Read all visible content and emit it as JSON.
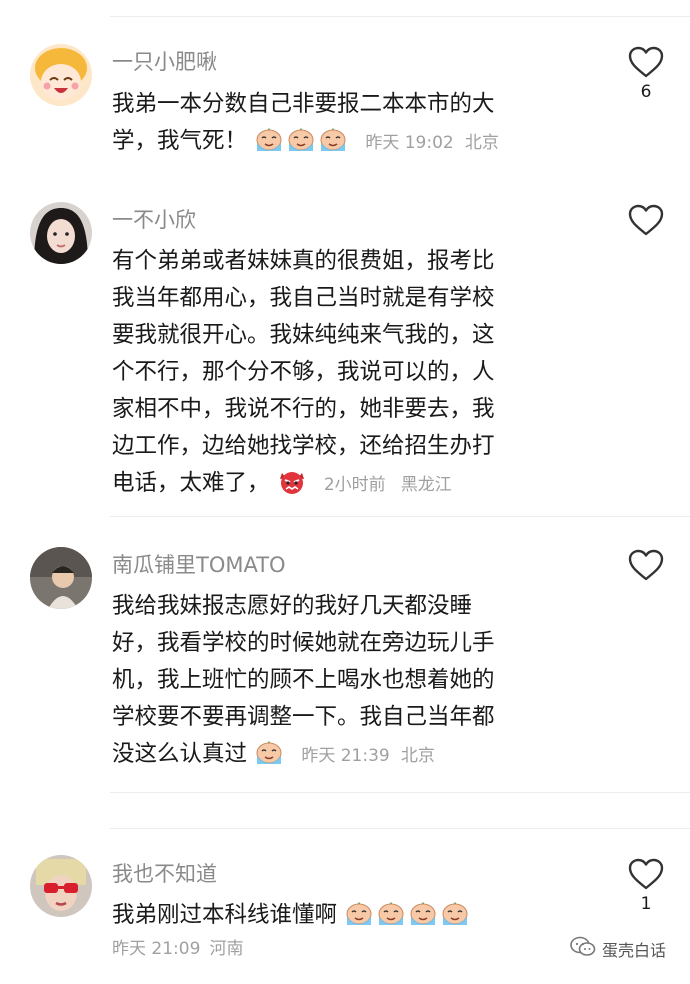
{
  "comments": [
    {
      "username": "一只小肥啾",
      "lines": [
        "我弟一本分数自己非要报二本本市的大",
        "学，我气死！"
      ],
      "time": "昨天 19:02",
      "location": "北京",
      "likes": "6",
      "emoji_count": 3,
      "emoji": "crying-face-emoji"
    },
    {
      "username": "一不小欣",
      "lines": [
        "有个弟弟或者妹妹真的很费姐，报考比",
        "我当年都用心，我自己当时就是有学校",
        "要我就很开心。我妹纯纯来气我的，这",
        "个不行，那个分不够，我说可以的，人",
        "家相不中，我说不行的，她非要去，我",
        "边工作，边给她找学校，还给招生办打",
        "电话，太难了，"
      ],
      "time": "2小时前",
      "location": "黑龙江",
      "likes": "",
      "emoji_count": 1,
      "emoji": "angry-devil-emoji"
    },
    {
      "username": "南瓜铺里TOMATO",
      "lines": [
        "我给我妹报志愿好的我好几天都没睡",
        "好，我看学校的时候她就在旁边玩儿手",
        "机，我上班忙的顾不上喝水也想着她的",
        "学校要不要再调整一下。我自己当年都",
        "没这么认真过"
      ],
      "time": "昨天 21:39",
      "location": "北京",
      "likes": "",
      "emoji_count": 1,
      "emoji": "crying-face-emoji"
    },
    {
      "username": "我也不知道",
      "lines": [
        "我弟刚过本科线谁懂啊"
      ],
      "time": "昨天 21:09",
      "location": "河南",
      "likes": "1",
      "emoji_count": 4,
      "emoji": "crying-face-emoji"
    }
  ],
  "watermark": "蛋壳白话",
  "colors": {
    "text": "#1a1a1a",
    "meta": "#a0a0a0",
    "username": "#8a8a8a"
  }
}
